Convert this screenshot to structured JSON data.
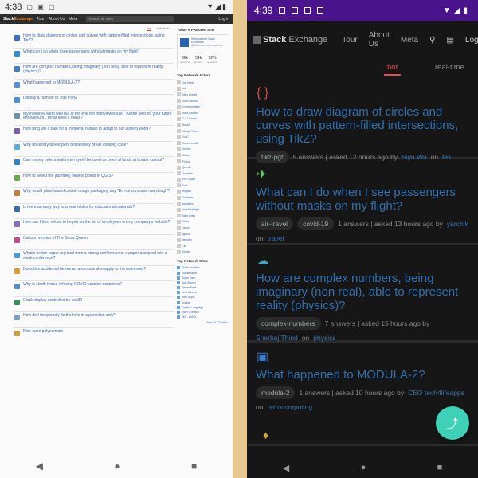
{
  "left": {
    "status": {
      "time": "4:38"
    },
    "topbar": {
      "logo_a": "Stack",
      "logo_b": "Exchange",
      "tour": "Tour",
      "about": "About Us",
      "meta": "Meta",
      "search_placeholder": "Search all sites",
      "login": "Log in"
    },
    "tabs": {
      "hot": "hot",
      "realtime": "real-time"
    },
    "questions": [
      {
        "title": "How to draw diagram of circles and curves with pattern-filled intersections, using TikZ?",
        "color": "#3c6bbf"
      },
      {
        "title": "What can I do when I see passengers without masks on my flight?",
        "color": "#2e8fd6"
      },
      {
        "title": "How are complex numbers, being imaginary (non real), able to represent reality (physics)?",
        "color": "#3f7fbf"
      },
      {
        "title": "What happened to MODULA-2?",
        "color": "#5a8fd0"
      },
      {
        "title": "Display a number in Tobi Pona",
        "color": "#4a90d9"
      },
      {
        "title": "My interview went well but at the end the interviewer said \"All the best for your future endeavours\". What does it mean?",
        "color": "#6f8fa8"
      },
      {
        "title": "How long will it take for a medieval human to adapt to our current world?",
        "color": "#7a5fb0"
      },
      {
        "title": "Why do library developers deliberately break existing code?",
        "color": "#5ab0d8"
      },
      {
        "title": "Can money orders written to myself be used as proof of funds at border control?",
        "color": "#2d84c8"
      },
      {
        "title": "How to select the [number] newest points in QGIS?",
        "color": "#6aa84f"
      },
      {
        "title": "Why would plant-based cookie dough packaging say \"Do not consume raw dough\"?",
        "color": "#c0803a"
      },
      {
        "title": "Is there an easy way to create tables for educational materials?",
        "color": "#3b6ea8"
      },
      {
        "title": "How can I best refuse to be put on the list of employees on my company's website?",
        "color": "#8a6fb8"
      },
      {
        "title": "Cartoon version of The Snow Queen",
        "color": "#c04e8a"
      },
      {
        "title": "What's better: paper rejected from a strong conference or a paper accepted into a weak conference?",
        "color": "#4f9ad0"
      },
      {
        "title": "Does this accidental before an anacrusis also apply to the main note?",
        "color": "#e0a030"
      },
      {
        "title": "Why is North Korea refusing COVID vaccine donations?",
        "color": "#5d8bc4"
      },
      {
        "title": "Clock display controlled by esp32",
        "color": "#3c8d5a"
      },
      {
        "title": "How do I temporarily fix the hole in a porcelain sink?",
        "color": "#7d9fc0"
      },
      {
        "title": "Nice cube polynomials",
        "color": "#c8a040"
      }
    ],
    "sidebar": {
      "featured_title": "Today's Featured Site",
      "featured_name": "Webmasters Stack Exchange",
      "featured_desc": "Q&A for pro webmasters",
      "stats": [
        {
          "n": "36k",
          "l": "questions"
        },
        {
          "n": "54k",
          "l": "answers"
        },
        {
          "n": "92%",
          "l": "answered"
        }
      ],
      "network_title": "Top Network Actors",
      "actors": [
        "Jon Skeet",
        "rolfl",
        "Marc Gravell",
        "Darin Dimitrov",
        "CommonsWare",
        "Hans Passant",
        "T.J. Crowder",
        "BalusC",
        "Martijn Pieters",
        "VonC",
        "Gordon Linoff",
        "Gumbo",
        "SLaks",
        "Pekka",
        "Quentin",
        "Jonathan",
        "Eric Lippert",
        "Kobi",
        "Raghav",
        "Johannes",
        "paxdiablo",
        "dasblinkenlight",
        "Mark Byers",
        "Guffa",
        "Jacob",
        "Ignacio",
        "kennytm",
        "Tim",
        "Hiroshi"
      ],
      "sites_title": "Top Network Sites",
      "sites": [
        "Stack Overflow",
        "Mathematics",
        "Super User",
        "Ask Ubuntu",
        "Server Fault",
        "Unix & Linux",
        "Web Apps",
        "Arqade",
        "English Language",
        "Math Overflow",
        "TeX - LaTeX"
      ],
      "view_all": "View all 177 sites »"
    }
  },
  "right": {
    "status": {
      "time": "4:39"
    },
    "appbar": {
      "logo_a": "Stack",
      "logo_b": "Exchange",
      "tour": "Tour",
      "about": "About Us",
      "meta": "Meta",
      "login": "Log"
    },
    "tabs": {
      "hot": "hot",
      "realtime": "real-time"
    },
    "questions": [
      {
        "icon": "{ }",
        "icon_color": "#e04a3a",
        "title": "How to draw diagram of circles and curves with pattern-filled intersections, using TikZ?",
        "tags": [
          "tikz-pgf"
        ],
        "meta": "5 answers | asked 12 hours ago by",
        "user": "Siyu Wu",
        "on": "on",
        "site": "tex"
      },
      {
        "icon": "✈",
        "icon_color": "#5fd06a",
        "title": "What can I do when I see passengers without masks on my flight?",
        "tags": [
          "air-travel",
          "covid-19"
        ],
        "meta": "1 answers | asked 13 hours ago by",
        "user": "yarchik",
        "on": "on",
        "site": "travel"
      },
      {
        "icon": "☁",
        "icon_color": "#4aa0b8",
        "title": "How are complex numbers, being imaginary (non real), able to represent reality (physics)?",
        "tags": [
          "complex-numbers"
        ],
        "meta": "7 answers | asked 15 hours ago by",
        "user": "Sherbaj Thind",
        "on": "on",
        "site": "physics"
      },
      {
        "icon": "▣",
        "icon_color": "#3a7cd0",
        "title": "What happened to MODULA-2?",
        "tags": [
          "modula-2"
        ],
        "meta": "1 answers | asked 10 hours ago by",
        "user": "CEO tech4lifeapps",
        "on": "on",
        "site": "retrocomputing"
      }
    ],
    "fab": "share-icon"
  }
}
